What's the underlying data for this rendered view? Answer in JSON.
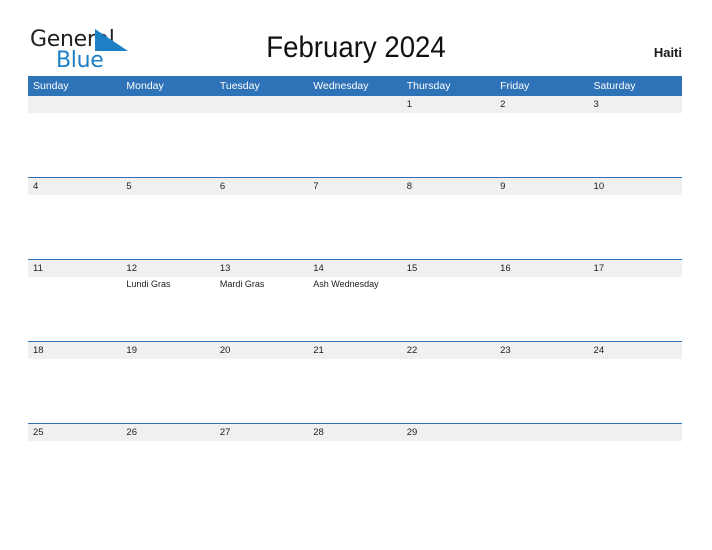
{
  "brand": {
    "name_part1": "General",
    "name_part2": "Blue",
    "flag_icon": "blue-flag-triangle",
    "accent_color": "#1f7fc4"
  },
  "header": {
    "title": "February 2024",
    "country": "Haiti"
  },
  "calendar": {
    "header_bg_color": "#2e72b8",
    "band_color": "#f0f0f0",
    "rule_color": "#2e72b8",
    "weekdays": [
      "Sunday",
      "Monday",
      "Tuesday",
      "Wednesday",
      "Thursday",
      "Friday",
      "Saturday"
    ],
    "weeks": [
      {
        "has_rule": false,
        "days": [
          {
            "number": "",
            "events": []
          },
          {
            "number": "",
            "events": []
          },
          {
            "number": "",
            "events": []
          },
          {
            "number": "",
            "events": []
          },
          {
            "number": "1",
            "events": []
          },
          {
            "number": "2",
            "events": []
          },
          {
            "number": "3",
            "events": []
          }
        ]
      },
      {
        "has_rule": true,
        "days": [
          {
            "number": "4",
            "events": []
          },
          {
            "number": "5",
            "events": []
          },
          {
            "number": "6",
            "events": []
          },
          {
            "number": "7",
            "events": []
          },
          {
            "number": "8",
            "events": []
          },
          {
            "number": "9",
            "events": []
          },
          {
            "number": "10",
            "events": []
          }
        ]
      },
      {
        "has_rule": true,
        "days": [
          {
            "number": "11",
            "events": []
          },
          {
            "number": "12",
            "events": [
              "Lundi Gras"
            ]
          },
          {
            "number": "13",
            "events": [
              "Mardi Gras"
            ]
          },
          {
            "number": "14",
            "events": [
              "Ash Wednesday"
            ]
          },
          {
            "number": "15",
            "events": []
          },
          {
            "number": "16",
            "events": []
          },
          {
            "number": "17",
            "events": []
          }
        ]
      },
      {
        "has_rule": true,
        "days": [
          {
            "number": "18",
            "events": []
          },
          {
            "number": "19",
            "events": []
          },
          {
            "number": "20",
            "events": []
          },
          {
            "number": "21",
            "events": []
          },
          {
            "number": "22",
            "events": []
          },
          {
            "number": "23",
            "events": []
          },
          {
            "number": "24",
            "events": []
          }
        ]
      },
      {
        "has_rule": true,
        "days": [
          {
            "number": "25",
            "events": []
          },
          {
            "number": "26",
            "events": []
          },
          {
            "number": "27",
            "events": []
          },
          {
            "number": "28",
            "events": []
          },
          {
            "number": "29",
            "events": []
          },
          {
            "number": "",
            "events": []
          },
          {
            "number": "",
            "events": []
          }
        ]
      }
    ]
  }
}
